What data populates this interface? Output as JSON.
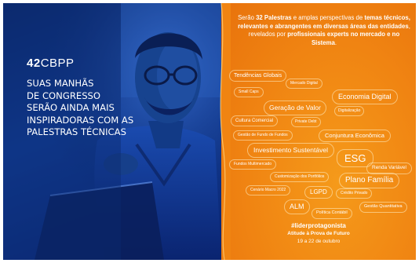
{
  "brand": {
    "number": "42",
    "name": "CBPP"
  },
  "headline": [
    "SUAS MANHÃS",
    "DE CONGRESSO",
    "SERÃO AINDA MAIS",
    "INSPIRADORAS COM AS",
    "PALESTRAS TÉCNICAS"
  ],
  "intro": {
    "part1": "Serão ",
    "bold1": "32 Palestras",
    "part2": " e amplas perspectivas de ",
    "bold2": "temas técnicos, relevantes e abrangentes em diversas áreas das entidades",
    "part3": ", revelados por ",
    "bold3": "profissionais experts no mercado e no Sistema",
    "part4": "."
  },
  "topics": [
    "Tendências Globais",
    "Mercado Digital",
    "Small Caps",
    "Economia Digital",
    "Geração de Valor",
    "Digitalização",
    "Cultura Comercial",
    "Private Debt",
    "Gestão de Fundo de Fundos",
    "Conjuntura Econômica",
    "Investimento Sustentável",
    "ESG",
    "Fundos Multimercado",
    "Renda Variável",
    "Customização dos Portfólios",
    "Plano Família",
    "Cenário Macro 2022",
    "LGPD",
    "Crédito Privado",
    "ALM",
    "Gestão Quantitativa",
    "Política Contábil"
  ],
  "footer": {
    "hashtag": "#liderprotagonista",
    "subtitle": "Atitude à Prova de Futuro",
    "dates": "19 a 22 de outubro"
  },
  "colors": {
    "blue": "#123f9a",
    "orange": "#f08412",
    "gold": "#ffd27a"
  }
}
